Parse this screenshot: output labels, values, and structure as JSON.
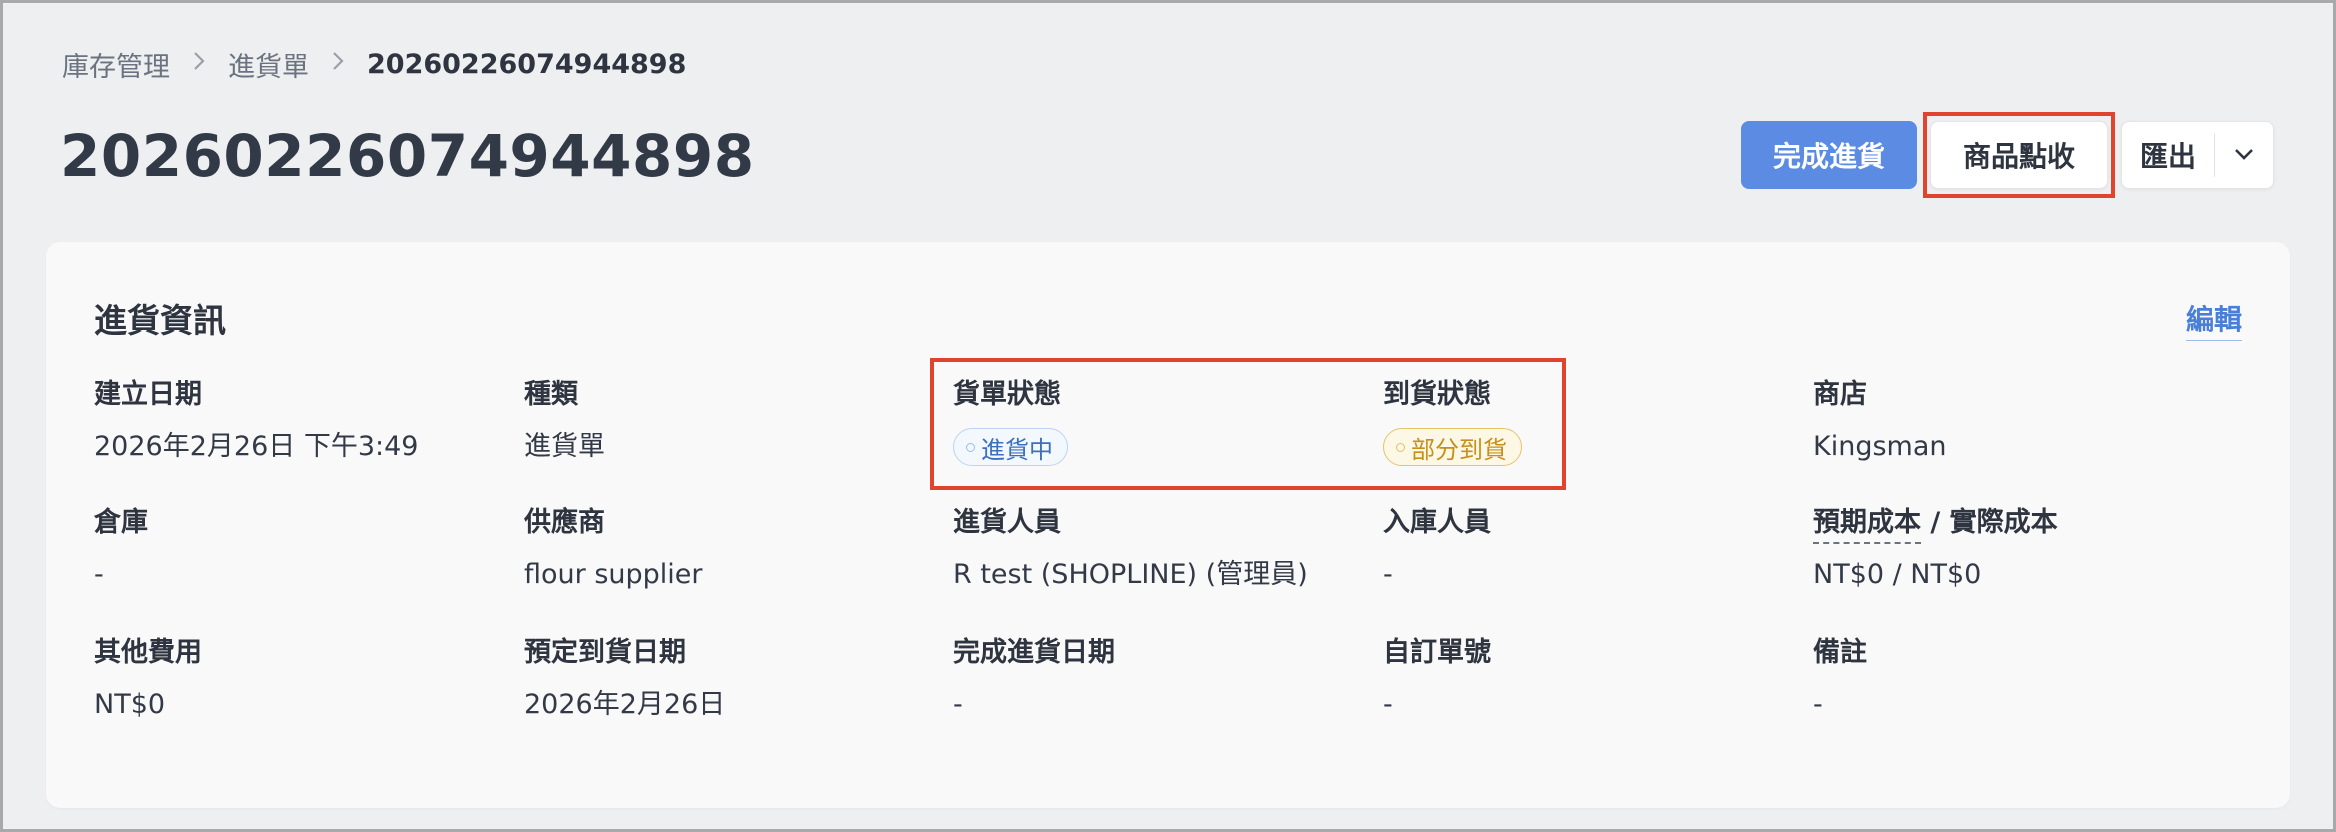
{
  "breadcrumb": {
    "items": [
      "庫存管理",
      "進貨單"
    ],
    "current": "20260226074944898"
  },
  "page_title": "20260226074944898",
  "actions": {
    "complete_label": "完成進貨",
    "receive_label": "商品點收",
    "export_label": "匯出",
    "primary_color": "#5b8be3",
    "highlight_color": "#e0442f"
  },
  "card": {
    "title": "進貨資訊",
    "edit_label": "編輯",
    "fields": {
      "created_date": {
        "label": "建立日期",
        "value": "2026年2月26日 下午3:49"
      },
      "type": {
        "label": "種類",
        "value": "進貨單"
      },
      "order_status": {
        "label": "貨單狀態",
        "value": "進貨中"
      },
      "arrival_status": {
        "label": "到貨狀態",
        "value": "部分到貨"
      },
      "store": {
        "label": "商店",
        "value": "Kingsman"
      },
      "warehouse": {
        "label": "倉庫",
        "value": "-"
      },
      "supplier": {
        "label": "供應商",
        "value": "flour supplier"
      },
      "purchaser": {
        "label": "進貨人員",
        "value": "R test (SHOPLINE) (管理員)"
      },
      "receiver": {
        "label": "入庫人員",
        "value": "-"
      },
      "cost": {
        "label_expected": "預期成本",
        "label_sep": " / ",
        "label_actual": "實際成本",
        "value": "NT$0 / NT$0"
      },
      "other_fees": {
        "label": "其他費用",
        "value": "NT$0"
      },
      "expected_arrival": {
        "label": "預定到貨日期",
        "value": "2026年2月26日"
      },
      "completed_date": {
        "label": "完成進貨日期",
        "value": "-"
      },
      "custom_number": {
        "label": "自訂單號",
        "value": "-"
      },
      "notes": {
        "label": "備註",
        "value": "-"
      }
    }
  }
}
